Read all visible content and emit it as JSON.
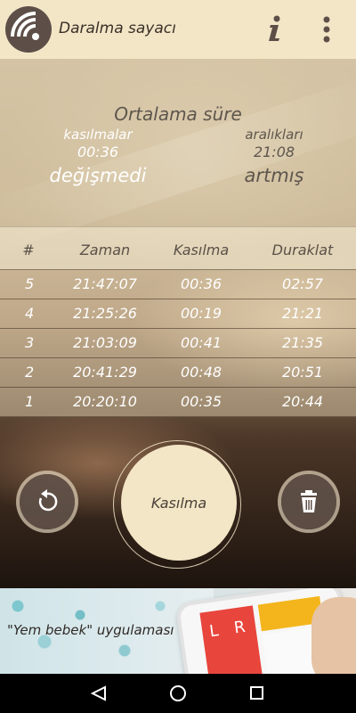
{
  "app": {
    "title": "Daralma sayacı"
  },
  "header": {
    "logo_icon": "signal-arcs-icon",
    "info_icon": "info-icon",
    "menu_icon": "vertical-dots-icon"
  },
  "summary": {
    "title": "Ortalama süre",
    "contractions": {
      "label": "kasılmalar",
      "value": "00:36",
      "trend": "değişmedi"
    },
    "intervals": {
      "label": "aralıkları",
      "value": "21:08",
      "trend": "artmış"
    }
  },
  "table": {
    "headers": [
      "#",
      "Zaman",
      "Kasılma",
      "Duraklat"
    ],
    "rows": [
      [
        "5",
        "21:47:07",
        "00:36",
        "02:57"
      ],
      [
        "4",
        "21:25:26",
        "00:19",
        "21:21"
      ],
      [
        "3",
        "21:03:09",
        "00:41",
        "21:35"
      ],
      [
        "2",
        "20:41:29",
        "00:48",
        "20:51"
      ],
      [
        "1",
        "20:20:10",
        "00:35",
        "20:44"
      ]
    ]
  },
  "controls": {
    "main_label": "Kasılma",
    "undo_icon": "undo-icon",
    "trash_icon": "trash-icon"
  },
  "ad": {
    "text": "\"Yem bebek\" uygulaması",
    "phone_tiles": [
      "L",
      "R"
    ]
  },
  "navbar": {
    "back_icon": "back-triangle-icon",
    "home_icon": "home-circle-icon",
    "recents_icon": "recents-square-icon"
  },
  "colors": {
    "header_bg": "#f2e6c7",
    "accent_dark": "#5d4f48",
    "button_light": "#f3e6c6"
  }
}
